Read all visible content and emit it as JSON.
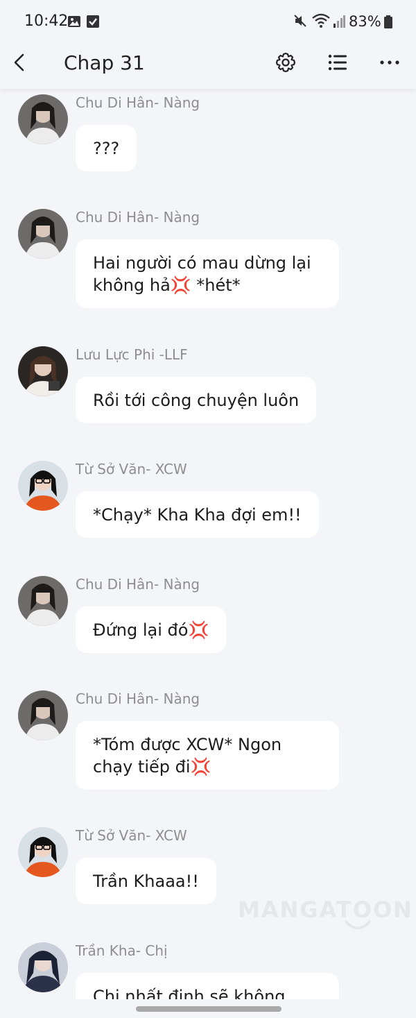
{
  "status_bar": {
    "time": "10:42",
    "battery": "83%",
    "icons": [
      "gallery-icon",
      "checkbox-icon",
      "mute-icon",
      "wifi-icon",
      "signal-icon",
      "battery-icon"
    ]
  },
  "header": {
    "title": "Chap 31",
    "icons": [
      "back-arrow-icon",
      "gear-icon",
      "list-icon",
      "more-dots-icon"
    ]
  },
  "messages": [
    {
      "sender": "Chu Di Hân- Nàng",
      "text": "???"
    },
    {
      "sender": "Chu Di Hân- Nàng",
      "text": "Hai người có mau dừng lại\nkhông hả💢 *hét*"
    },
    {
      "sender": "Lưu Lực Phi -LLF",
      "text": "Rồi tới công chuyện luôn"
    },
    {
      "sender": "Từ Sở Văn- XCW",
      "text": "*Chạy* Kha Kha đợi em!!"
    },
    {
      "sender": "Chu Di Hân- Nàng",
      "text": "Đứng lại đó💢"
    },
    {
      "sender": "Chu Di Hân- Nàng",
      "text": "*Tóm được XCW* Ngon\nchạy tiếp đi💢"
    },
    {
      "sender": "Từ Sở Văn- XCW",
      "text": "Trần Khaaa!!"
    },
    {
      "sender": "Trần Kha- Chị",
      "text": "Chị nhất định sẽ không"
    }
  ],
  "watermark": "MANGATOON",
  "colors": {
    "background": "#f4f5f8",
    "bubble": "#ffffff",
    "sender_text": "#8e8e8e",
    "anger_emoji": "#e0245e"
  }
}
